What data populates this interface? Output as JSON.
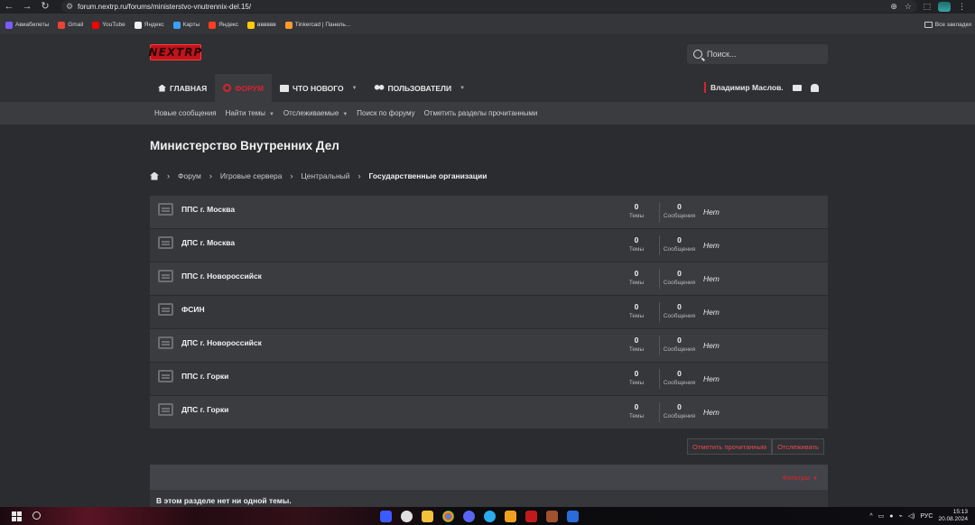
{
  "browser": {
    "url": "forum.nextrp.ru/forums/ministerstvo-vnutrennix-del.15/",
    "bookmarks": [
      "Авиабилеты",
      "Gmail",
      "YouTube",
      "Яндекс",
      "Карты",
      "Яндекс",
      "вввввв",
      "Tinkercad | Панель..."
    ],
    "all_bookmarks_label": "Все закладки"
  },
  "header": {
    "logo_text": "NEXTRP",
    "search_placeholder": "Поиск...",
    "tabs": [
      {
        "label": "ГЛАВНАЯ",
        "icon": "home-icon",
        "active": false
      },
      {
        "label": "ФОРУМ",
        "icon": "gear-icon",
        "active": true
      },
      {
        "label": "ЧТО НОВОГО",
        "icon": "chat-icon",
        "active": false
      },
      {
        "label": "ПОЛЬЗОВАТЕЛИ",
        "icon": "users-icon",
        "active": false
      }
    ],
    "user_name": "Владимир Маслов."
  },
  "subnav": {
    "items": [
      "Новые сообщения",
      "Найти темы",
      "Отслеживаемые",
      "Поиск по форуму",
      "Отметить разделы прочитанными"
    ]
  },
  "page": {
    "title": "Министерство Внутренних Дел",
    "breadcrumbs": [
      "Форум",
      "Игровые сервера",
      "Центральный",
      "Государственные организации"
    ]
  },
  "forums": [
    {
      "name": "ППС г. Москва",
      "threads": "0",
      "messages": "0",
      "last": "Нет"
    },
    {
      "name": "ДПС г. Москва",
      "threads": "0",
      "messages": "0",
      "last": "Нет"
    },
    {
      "name": "ППС г. Новороссийск",
      "threads": "0",
      "messages": "0",
      "last": "Нет"
    },
    {
      "name": "ФСИН",
      "threads": "0",
      "messages": "0",
      "last": "Нет"
    },
    {
      "name": "ДПС г. Новороссийск",
      "threads": "0",
      "messages": "0",
      "last": "Нет"
    },
    {
      "name": "ППС г. Горки",
      "threads": "0",
      "messages": "0",
      "last": "Нет"
    },
    {
      "name": "ДПС г. Горки",
      "threads": "0",
      "messages": "0",
      "last": "Нет"
    }
  ],
  "labels": {
    "threads": "Темы",
    "messages": "Сообщения"
  },
  "actions": {
    "mark_read": "Отметить прочитанным",
    "watch": "Отслеживать"
  },
  "filters_label": "Фильтры",
  "empty_text": "В этом разделе нет ни одной темы.",
  "taskbar": {
    "lang": "РУС",
    "time": "15:13",
    "date": "20.08.2024"
  }
}
